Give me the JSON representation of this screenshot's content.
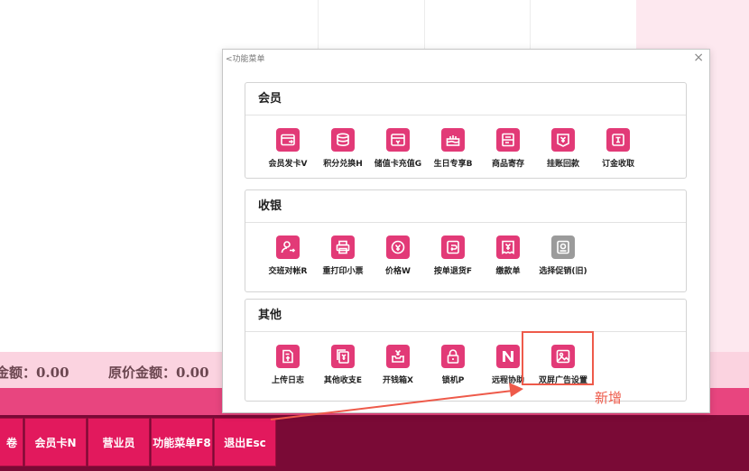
{
  "amount_bar": {
    "payable": "金额：0.00",
    "original": "原价金额：0.00"
  },
  "fkeys": [
    {
      "label": "卷"
    },
    {
      "label": "会员卡N"
    },
    {
      "label": "营业员"
    },
    {
      "label": "功能菜单F8"
    },
    {
      "label": "退出Esc"
    }
  ],
  "dialog": {
    "title": "<功能菜单",
    "close_glyph": "×",
    "sections": [
      {
        "title": "会员",
        "items": [
          {
            "label": "会员发卡V",
            "icon": "card-issue-icon"
          },
          {
            "label": "积分兑换H",
            "icon": "coins-icon"
          },
          {
            "label": "储值卡充值G",
            "icon": "stored-card-icon"
          },
          {
            "label": "生日专享B",
            "icon": "birthday-cake-icon"
          },
          {
            "label": "商品寄存",
            "icon": "storage-icon"
          },
          {
            "label": "挂账回款",
            "icon": "receipt-return-icon"
          },
          {
            "label": "订金收取",
            "icon": "deposit-icon"
          }
        ]
      },
      {
        "title": "收银",
        "items": [
          {
            "label": "交班对帐R",
            "icon": "shift-handover-icon"
          },
          {
            "label": "重打印小票",
            "icon": "printer-icon"
          },
          {
            "label": "价格W",
            "icon": "price-tag-icon"
          },
          {
            "label": "按单退货F",
            "icon": "return-goods-icon"
          },
          {
            "label": "缴款单",
            "icon": "payment-slip-icon"
          },
          {
            "label": "选择促销(旧)",
            "icon": "promotion-icon"
          }
        ]
      },
      {
        "title": "其他",
        "items": [
          {
            "label": "上传日志",
            "icon": "upload-log-icon"
          },
          {
            "label": "其他收支E",
            "icon": "other-income-icon"
          },
          {
            "label": "开钱箱X",
            "icon": "cash-drawer-icon"
          },
          {
            "label": "锁机P",
            "icon": "lock-icon"
          },
          {
            "label": "远程协助",
            "icon": "remote-assist-icon"
          },
          {
            "label": "双屏广告设置",
            "icon": "dual-screen-ad-icon"
          }
        ]
      }
    ]
  },
  "annotation": {
    "new_label": "新增"
  },
  "colors": {
    "accent": "#e23a77",
    "bottom_bar": "#7a0a36",
    "annotation": "#ee5a4a"
  }
}
